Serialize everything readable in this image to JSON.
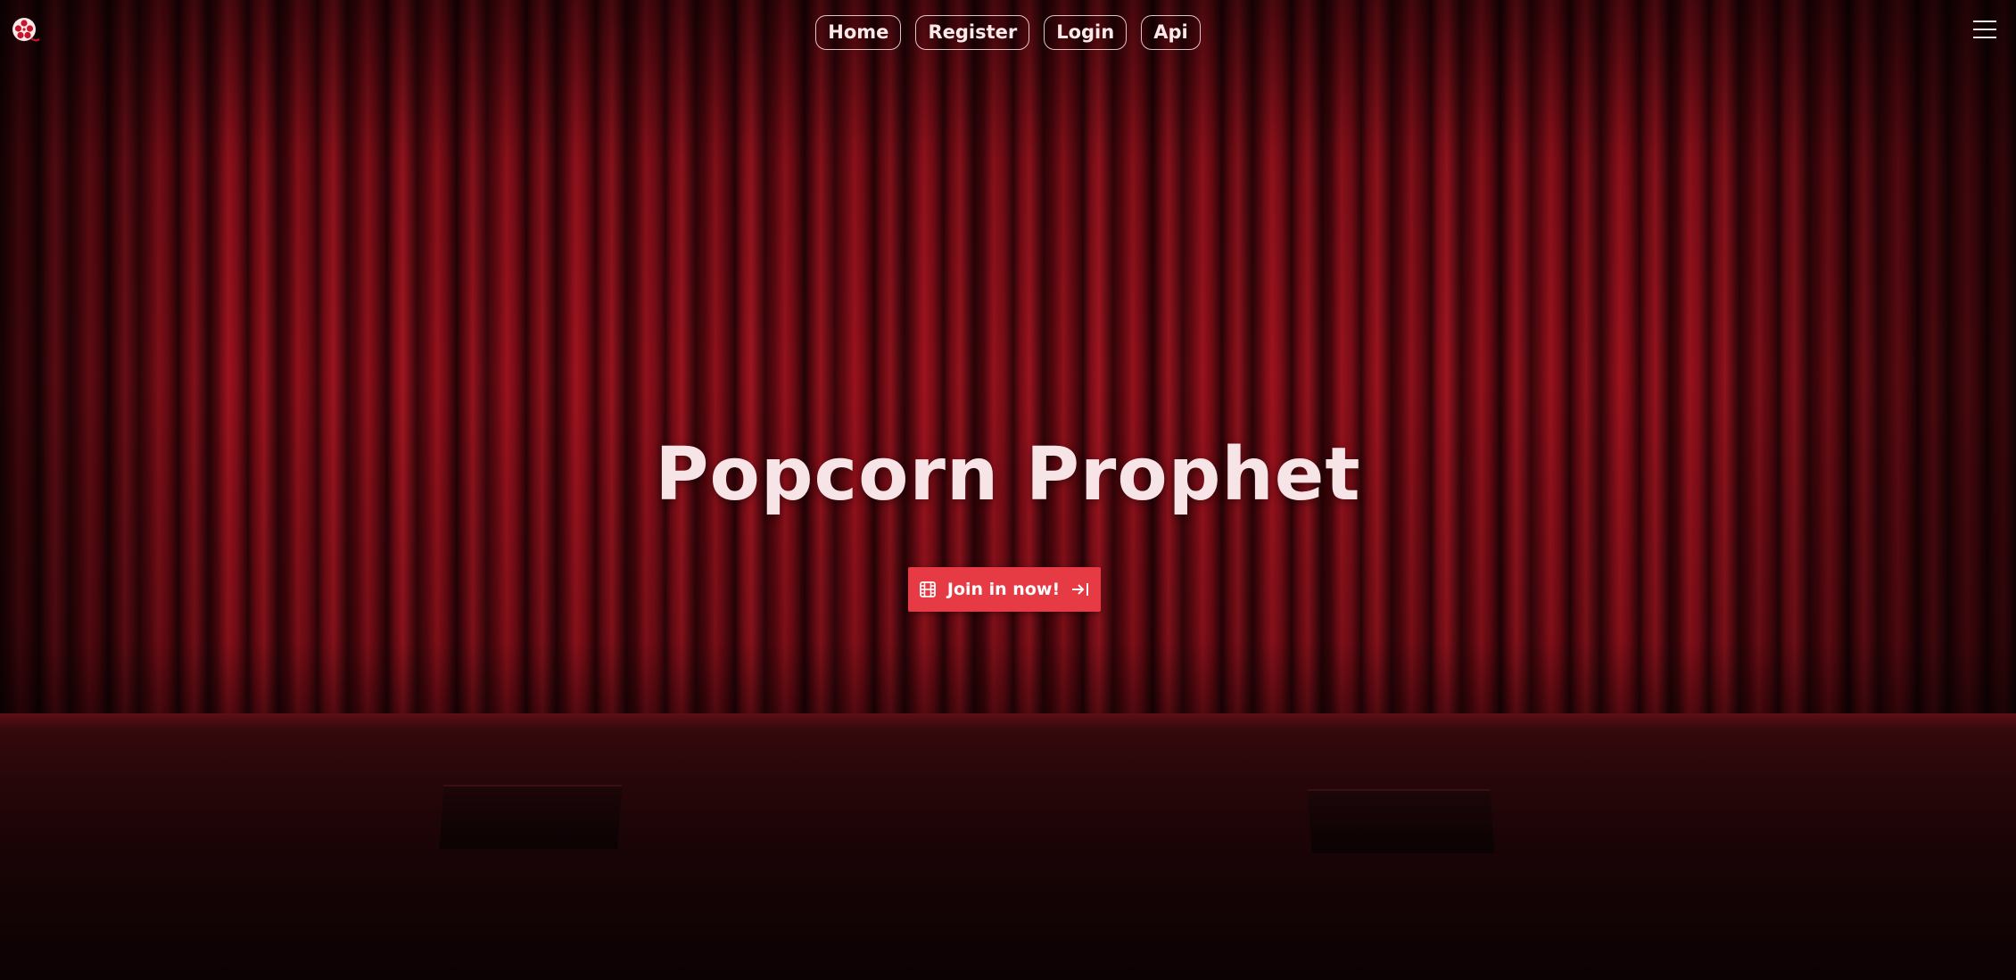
{
  "nav": {
    "items": [
      {
        "label": "Home"
      },
      {
        "label": "Register"
      },
      {
        "label": "Login"
      },
      {
        "label": "Api"
      }
    ]
  },
  "hero": {
    "title": "Popcorn Prophet",
    "cta_label": "Join in now!"
  },
  "icons": {
    "logo": "film-reel-icon",
    "menu": "hamburger-menu-icon",
    "cta_leading": "film-icon",
    "cta_trailing": "arrow-right-to-bar-icon"
  },
  "colors": {
    "accent": "#e63a44",
    "curtain": "#8a0e1a",
    "text": "#f7e4e6"
  }
}
